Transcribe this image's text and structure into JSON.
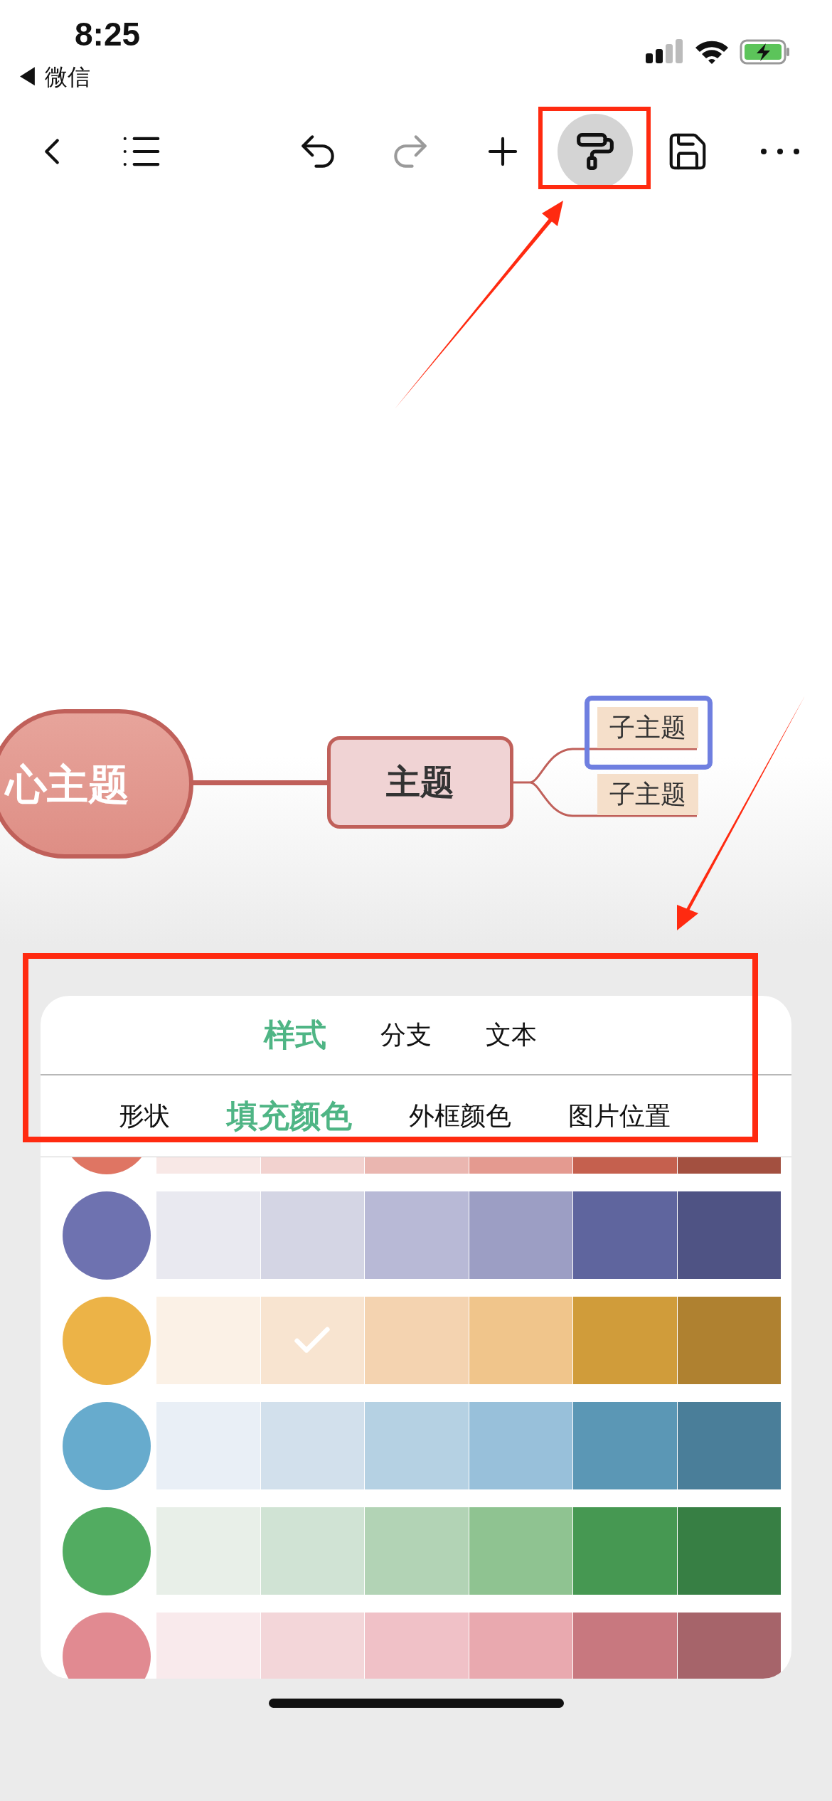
{
  "status_bar": {
    "time": "8:25",
    "back_label": "◀ 微信"
  },
  "toolbar": {
    "items": [
      {
        "kind": "back",
        "disabled": false,
        "selected": false
      },
      {
        "kind": "outline",
        "disabled": false,
        "selected": false
      },
      {
        "kind": "undo",
        "disabled": false,
        "selected": false
      },
      {
        "kind": "redo",
        "disabled": true,
        "selected": false
      },
      {
        "kind": "add",
        "disabled": false,
        "selected": false
      },
      {
        "kind": "style",
        "disabled": false,
        "selected": true
      },
      {
        "kind": "save",
        "disabled": false,
        "selected": false
      },
      {
        "kind": "more",
        "disabled": false,
        "selected": false
      }
    ]
  },
  "mind_map": {
    "central": "心主题",
    "topic": "主题",
    "subtopics": [
      {
        "label": "子主题",
        "selected": true
      },
      {
        "label": "子主题",
        "selected": false
      }
    ]
  },
  "panel": {
    "tabs": [
      {
        "label": "样式",
        "selected": true
      },
      {
        "label": "分支",
        "selected": false
      },
      {
        "label": "文本",
        "selected": false
      }
    ],
    "subtabs": [
      {
        "label": "形状",
        "selected": false
      },
      {
        "label": "填充颜色",
        "selected": true
      },
      {
        "label": "外框颜色",
        "selected": false
      },
      {
        "label": "图片位置",
        "selected": false
      }
    ],
    "palettes": [
      {
        "color": "#df7563",
        "swatches": [
          {
            "color": "#f8e8e6"
          },
          {
            "color": "#f2d2cf"
          },
          {
            "color": "#eab6b0"
          },
          {
            "color": "#e49a90"
          },
          {
            "color": "#c5604e"
          },
          {
            "color": "#a35040"
          }
        ]
      },
      {
        "color": "#6e72b0",
        "swatches": [
          {
            "color": "#e9e9f0",
            "selected": false
          },
          {
            "color": "#d4d5e4",
            "selected": false
          },
          {
            "color": "#b8b9d6",
            "selected": false
          },
          {
            "color": "#9c9ec4",
            "selected": false
          },
          {
            "color": "#5f659e",
            "selected": false
          },
          {
            "color": "#4f5384",
            "selected": false
          }
        ]
      },
      {
        "color": "#ecb347",
        "swatches": [
          {
            "color": "#fbf1e6",
            "selected": false
          },
          {
            "color": "#f8e4d0",
            "selected": true
          },
          {
            "color": "#f4d3b0",
            "selected": false
          },
          {
            "color": "#f0c58b",
            "selected": false
          },
          {
            "color": "#d09c3a",
            "selected": false
          },
          {
            "color": "#af8130",
            "selected": false
          }
        ]
      },
      {
        "color": "#67abcd",
        "swatches": [
          {
            "color": "#e9eff6",
            "selected": false
          },
          {
            "color": "#d2e0ec",
            "selected": false
          },
          {
            "color": "#b5d1e3",
            "selected": false
          },
          {
            "color": "#98c0da",
            "selected": false
          },
          {
            "color": "#5b97b5",
            "selected": false
          },
          {
            "color": "#4a7e99",
            "selected": false
          }
        ]
      },
      {
        "color": "#52ac61",
        "swatches": [
          {
            "color": "#e8efe8",
            "selected": false
          },
          {
            "color": "#d0e3d4",
            "selected": false
          },
          {
            "color": "#b2d3b5",
            "selected": false
          },
          {
            "color": "#8fc391",
            "selected": false
          },
          {
            "color": "#469852",
            "selected": false
          },
          {
            "color": "#377f44",
            "selected": false
          }
        ]
      },
      {
        "color": "#e18a91",
        "swatches": [
          {
            "color": "#f9eaec",
            "selected": false
          },
          {
            "color": "#f3d6d9",
            "selected": false
          },
          {
            "color": "#f0c1c7",
            "selected": false
          },
          {
            "color": "#e9a9af",
            "selected": false
          },
          {
            "color": "#c8787f",
            "selected": false
          },
          {
            "color": "#a6646a",
            "selected": false
          }
        ]
      }
    ]
  }
}
